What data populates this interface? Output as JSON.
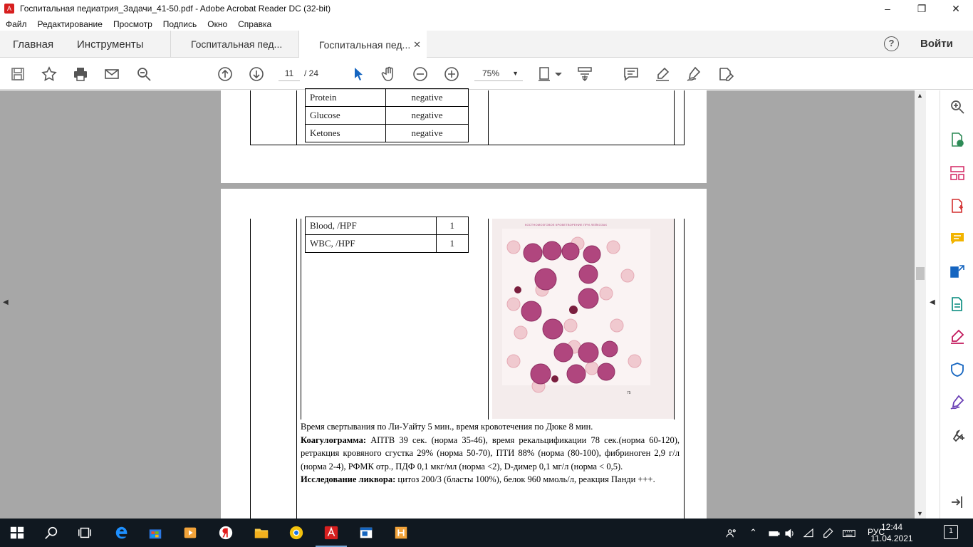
{
  "window": {
    "title": "Госпитальная педиатрия_Задачи_41-50.pdf - Adobe Acrobat Reader DC (32-bit)",
    "controls": [
      "–",
      "❐",
      "✕"
    ]
  },
  "menu": [
    "Файл",
    "Редактирование",
    "Просмотр",
    "Подпись",
    "Окно",
    "Справка"
  ],
  "tabs": {
    "home": "Главная",
    "tools": "Инструменты",
    "docs": [
      {
        "label": "Госпитальная пед...",
        "active": false
      },
      {
        "label": "Госпитальная пед...",
        "active": true
      }
    ],
    "close_glyph": "✕",
    "help_glyph": "?",
    "signin": "Войти"
  },
  "toolbar": {
    "page_current": "11",
    "page_total": "/ 24",
    "zoom": "75%",
    "zoom_caret": "▼"
  },
  "document": {
    "table_top": [
      {
        "name": "Protein",
        "value": "negative"
      },
      {
        "name": "Glucose",
        "value": "negative"
      },
      {
        "name": "Ketones",
        "value": "negative"
      }
    ],
    "table_bottom": [
      {
        "name": "Blood, /HPF",
        "value": "1"
      },
      {
        "name": "WBC, /HPF",
        "value": "1"
      }
    ],
    "micro_header": "КОСТНОМОЗГОВОЕ КРОВЕТВОРЕНИЕ ПРИ ЛЕЙКОЗАХ",
    "micro_pagenum": "75",
    "line1": "Время свертывания по Ли-Уайту 5 мин., время кровотечения по Дюке 8 мин.",
    "coag_label": "Коагулограмма:",
    "coag_text": " АПТВ 39 сек. (норма 35-46), время рекальцификации 78 сек.(норма 60-120), ретракция кровяного сгустка  29% (норма 50-70), ПТИ  88% (норма (80-100), фибриноген 2,9 г/л (норма 2-4), РФМК отр., ПДФ 0,1 мкг/мл (норма <2), D-димер 0,1 мг/л (норма < 0,5).",
    "csf_label": "Исследование ликвора:",
    "csf_text": " цитоз 200/3 (бласты 100%), белок 960 ммоль/л, реакция Панди +++."
  },
  "taskbar": {
    "lang": "РУС",
    "time": "12:44",
    "date": "11.04.2021",
    "notif_count": "1"
  },
  "colors": {
    "acrobat_red": "#d71f1f",
    "viewer_bg": "#a7a7a7",
    "taskbar_bg": "#101820",
    "cell_purple": "#b0467e"
  }
}
